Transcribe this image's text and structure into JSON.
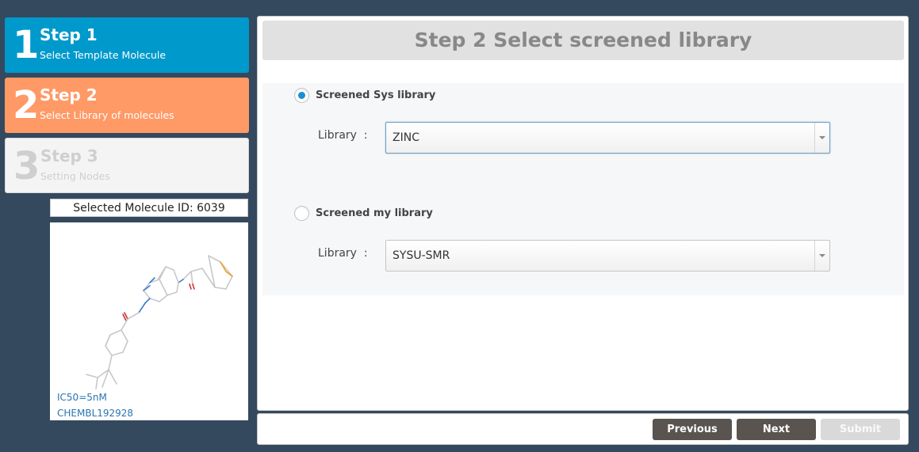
{
  "steps": [
    {
      "number": "1",
      "title": "Step 1",
      "subtitle": "Select Template Molecule",
      "state": "done",
      "color": "#0099cc"
    },
    {
      "number": "2",
      "title": "Step 2",
      "subtitle": "Select Library of molecules",
      "state": "active",
      "color": "#ff9966"
    },
    {
      "number": "3",
      "title": "Step 3",
      "subtitle": "Setting Nodes",
      "state": "disabled",
      "color": "#f4f4f4"
    }
  ],
  "molecule": {
    "id_label": "Selected Molecule ID: 6039",
    "ic50": "IC50=5nM",
    "chembl_id": "CHEMBL192928"
  },
  "main": {
    "header": "Step 2 Select screened library",
    "options": [
      {
        "label": "Screened Sys library",
        "checked": true,
        "library_label": "Library  :",
        "library_value": "ZINC"
      },
      {
        "label": "Screened my library",
        "checked": false,
        "library_label": "Library  :",
        "library_value": "SYSU-SMR"
      }
    ]
  },
  "buttons": {
    "previous": "Previous",
    "next": "Next",
    "submit": "Submit"
  },
  "colors": {
    "background": "#34495e",
    "radio_checked": "#1a8fd6",
    "button_dark": "#5a5451",
    "button_disabled": "#d9d9d9"
  }
}
